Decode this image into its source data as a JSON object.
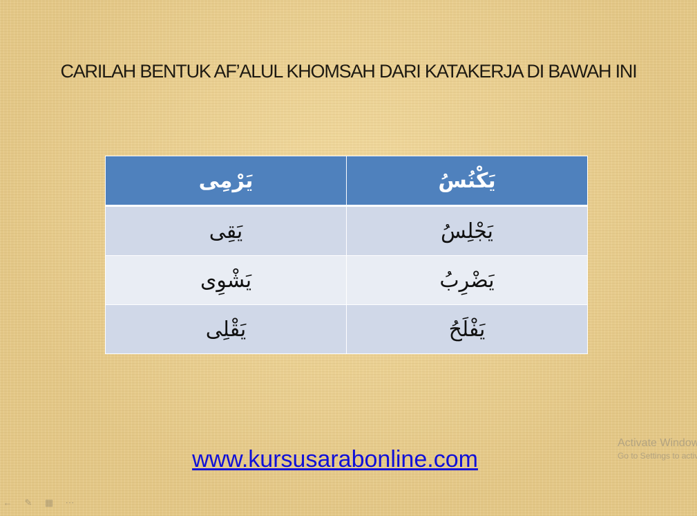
{
  "slide": {
    "title": "CARILAH BENTUK AF’ALUL KHOMSAH DARI KATAKERJA DI BAWAH INI",
    "table": {
      "headers": [
        "يَكْنُسُ",
        "يَرْمِى"
      ],
      "rows": [
        [
          "يَجْلِسُ",
          "يَقِى"
        ],
        [
          "يَضْرِبُ",
          "يَشْوِى"
        ],
        [
          "يَفْلَحُ",
          "يَقْلِى"
        ]
      ]
    },
    "link": "www.kursusarabonline.com"
  },
  "watermark": {
    "line1": "Activate Windows",
    "line2": "Go to Settings to activate Windows."
  },
  "controls": {
    "icons": [
      "arrow-icon",
      "pen-icon",
      "slides-icon",
      "more-icon"
    ]
  },
  "colors": {
    "header_bg": "#4f81bd",
    "row_odd_bg": "#d0d8e8",
    "row_even_bg": "#e9edf4",
    "link": "#1010d8"
  }
}
